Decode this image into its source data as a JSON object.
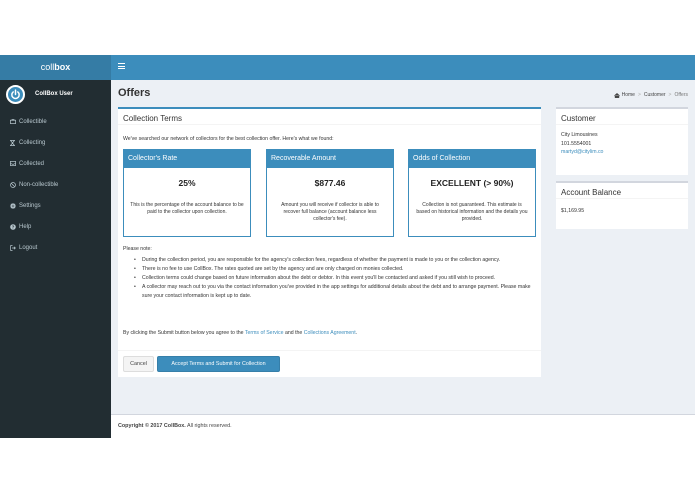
{
  "app": {
    "logo_prefix": "coll",
    "logo_suffix": "box",
    "user_name": "CollBox User"
  },
  "sidebar": {
    "items": [
      {
        "label": "Collectible",
        "icon": "briefcase-icon"
      },
      {
        "label": "Collecting",
        "icon": "hourglass-icon"
      },
      {
        "label": "Collected",
        "icon": "inbox-icon"
      },
      {
        "label": "Non-collectible",
        "icon": "ban-icon"
      },
      {
        "label": "Settings",
        "icon": "gear-icon"
      },
      {
        "label": "Help",
        "icon": "help-icon"
      },
      {
        "label": "Logout",
        "icon": "logout-icon"
      }
    ]
  },
  "page": {
    "title": "Offers",
    "breadcrumb": [
      "Home",
      "Customer",
      "Offers"
    ]
  },
  "terms": {
    "title": "Collection Terms",
    "intro": "We've searched our network of collectors for the best collection offer. Here's what we found:",
    "cards": [
      {
        "heading": "Collector's Rate",
        "value": "25%",
        "description": "This is the percentage of the account balance to be paid to the collector upon collection."
      },
      {
        "heading": "Recoverable Amount",
        "value": "$877.46",
        "description": "Amount you will receive if collector is able to recover full balance (account balance less collector's fee)."
      },
      {
        "heading": "Odds of Collection",
        "value": "EXCELLENT (> 90%)",
        "description": "Collection is not guaranteed. This estimate is based on historical information and the details you provided."
      }
    ],
    "note_label": "Please note:",
    "notes": [
      "During the collection period, you are responsible for the agency's collection fees, regardless of whether the payment is made to you or the collection agency.",
      "There is no fee to use CollBox. The rates quoted are set by the agency and are only charged on monies collected.",
      "Collection terms could change based on future information about the debt or debtor. In this event you'll be contacted and asked if you still wish to proceed.",
      "A collector may reach out to you via the contact information you've provided in the app settings for additional details about the debt and to arrange payment. Please make sure your contact information is kept up to date."
    ],
    "agree_prefix": "By clicking the Submit button below you agree to the ",
    "terms_link": "Terms of Service",
    "agree_mid": " and the ",
    "agreement_link": "Collections Agreement",
    "agree_suffix": ".",
    "cancel_label": "Cancel",
    "submit_label": "Accept Terms and Submit for Collection"
  },
  "customer": {
    "title": "Customer",
    "name": "City Limousines",
    "phone": "101.5554001",
    "email": "martyd@citylim.co"
  },
  "balance": {
    "title": "Account Balance",
    "value": "$1,169.95"
  },
  "footer": {
    "copyright": "Copyright © 2017 CollBox.",
    "rights": " All rights reserved."
  }
}
